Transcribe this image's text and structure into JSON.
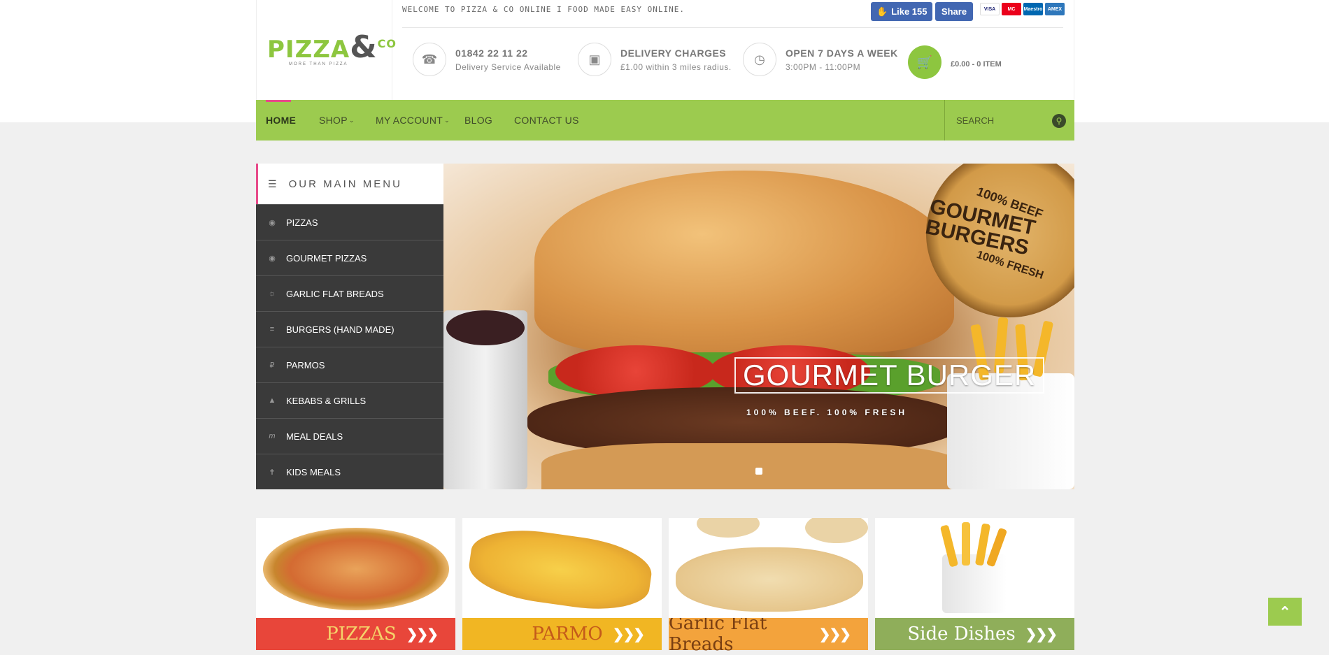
{
  "header": {
    "logo": {
      "main": "PIZZA",
      "amp": "&",
      "co": "CO",
      "tagline": "MORE THAN PIZZA"
    },
    "welcome": "WELCOME TO PIZZA & CO ONLINE I FOOD MADE EASY ONLINE.",
    "facebook": {
      "like": "Like 155",
      "share": "Share"
    },
    "cards": [
      "VISA",
      "MC",
      "Maestro",
      "AMEX"
    ],
    "info": [
      {
        "icon": "phone-icon",
        "title": "01842 22 11 22",
        "sub": "Delivery Service Available"
      },
      {
        "icon": "bus-icon",
        "title": "DELIVERY CHARGES",
        "sub": "£1.00 within 3 miles radius."
      },
      {
        "icon": "clock-icon",
        "title": "OPEN 7 DAYS A WEEK",
        "sub": "3:00PM - 11:00PM"
      }
    ],
    "cart": "£0.00 - 0 ITEM"
  },
  "nav": {
    "items": [
      "HOME",
      "SHOP",
      "MY ACCOUNT",
      "BLOG",
      "CONTACT US"
    ],
    "search_placeholder": "SEARCH"
  },
  "sidebar": {
    "title": "OUR MAIN MENU",
    "items": [
      "PIZZAS",
      "GOURMET PIZZAS",
      "GARLIC FLAT BREADS",
      "BURGERS (HAND MADE)",
      "PARMOS",
      "KEBABS & GRILLS",
      "MEAL DEALS",
      "KIDS MEALS"
    ]
  },
  "hero": {
    "title": "GOURMET BURGER",
    "subtitle": "100% BEEF. 100% FRESH",
    "stamp": {
      "top": "100% BEEF",
      "main": "GOURMET BURGERS",
      "bottom": "100% FRESH"
    }
  },
  "tiles": [
    {
      "label": "PIZZAS",
      "color": "#e8463a",
      "text_color": "#f5d36a"
    },
    {
      "label": "PARMO",
      "color": "#f1b623",
      "text_color": "#c45a1a"
    },
    {
      "label": "Garlic Flat Breads",
      "color": "#f3a33c",
      "text_color": "#7a3f12"
    },
    {
      "label": "Side Dishes",
      "color": "#8fae5a",
      "text_color": "#ffffff"
    }
  ],
  "colors": {
    "accent": "#9ccb4f",
    "pink": "#e84a8a",
    "sidebar": "#3a3a3a"
  }
}
